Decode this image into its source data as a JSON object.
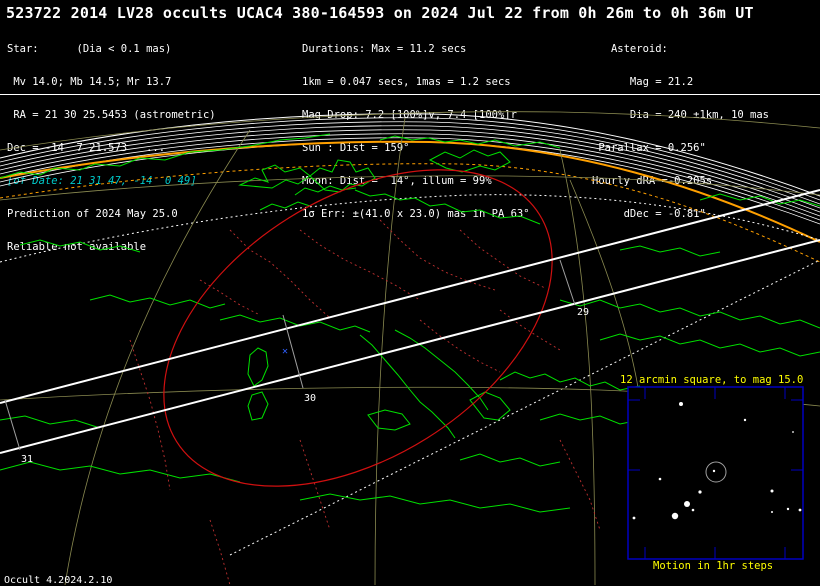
{
  "header": {
    "title": "523722 2014 LV28 occults UCAC4 380-164593 on 2024 Jul 22 from  0h 26m to  0h 36m UT"
  },
  "star": {
    "line1": "Star:      (Dia < 0.1 mas)",
    "line2": " Mv 14.0; Mb 14.5; Mr 13.7",
    "line3": " RA = 21 30 25.5453 (astrometric)",
    "line4": "Dec = -14  7 21.573   ...",
    "line5": "[of Date: 21 31 47, -14  0 49]",
    "line6": "Prediction of 2024 May 25.0",
    "line7": "Reliable not available"
  },
  "event": {
    "line1": "Durations: Max = 11.2 secs",
    "line2": "1km = 0.047 secs, 1mas = 1.2 secs",
    "line3": "Mag Drop: 7.2 [100%]v, 7.4 [100%]r",
    "line4": "Sun : Dist = 159°",
    "line5": "Moon: Dist =  14°, illum = 99%",
    "line6": "1σ Err: ±(41.0 x 23.0) mas in PA 63°"
  },
  "asteroid": {
    "line1": "   Asteroid:",
    "line2": "      Mag = 21.2",
    "line3": "      Dia = 240 ±1km, 10 mas",
    "line4": " Parallax = 0.256\"",
    "line5": "Hourly dRA =-0.205s",
    "line6": "     dDec = -0.81\""
  },
  "map": {
    "time_labels": [
      "29",
      "30",
      "31"
    ],
    "colors": {
      "coast": "#00e000",
      "borders": "#c03030",
      "grid": "#a0a060",
      "path": "#ffffff",
      "sigma": "#ffa000",
      "error_ellipse": "#d01010",
      "star_field": "#0000c0",
      "caption": "#ffff00"
    }
  },
  "inset": {
    "caption": "12 arcmin square, to mag 15.0",
    "footer": "Motion in 1hr steps"
  },
  "footer": {
    "version": "Occult 4.2024.2.10"
  }
}
